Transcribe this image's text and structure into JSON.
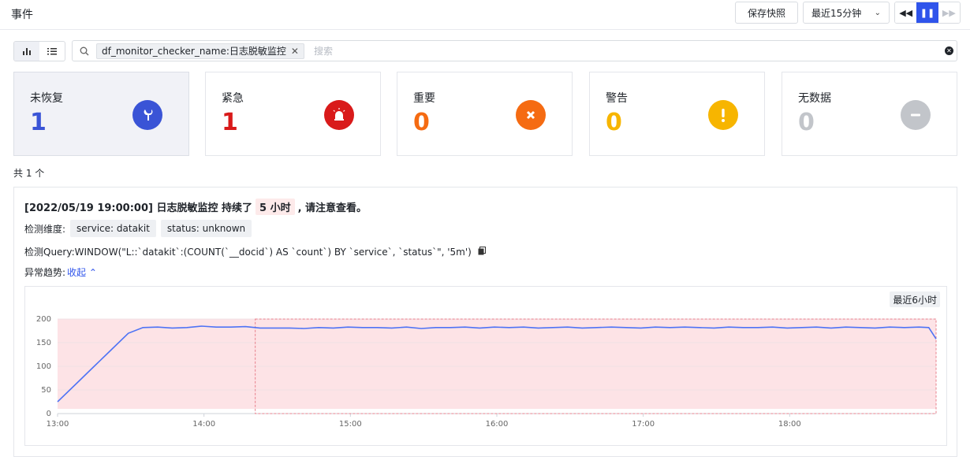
{
  "header": {
    "title": "事件",
    "save_snapshot": "保存快照",
    "time_range": "最近15分钟",
    "play_controls": [
      "◀◀",
      "❚❚",
      "▶▶"
    ]
  },
  "search": {
    "tag": "df_monitor_checker_name:日志脱敏监控",
    "placeholder": "搜索"
  },
  "stats": [
    {
      "label": "未恢复",
      "count": "1",
      "color": "#3a54d6",
      "icon": "wrench-icon"
    },
    {
      "label": "紧急",
      "count": "1",
      "color": "#d91a1a",
      "icon": "alarm-icon"
    },
    {
      "label": "重要",
      "count": "0",
      "color": "#f56b12",
      "icon": "close-icon"
    },
    {
      "label": "警告",
      "count": "0",
      "color": "#f7b500",
      "icon": "exclamation-icon"
    },
    {
      "label": "无数据",
      "count": "0",
      "color": "#c2c5ca",
      "icon": "minus-icon"
    }
  ],
  "total_text": "共 1 个",
  "event": {
    "title_prefix": "[2022/05/19 19:00:00] 日志脱敏监控 持续了",
    "duration": "5 小时",
    "title_suffix": ", 请注意查看。",
    "dimensions_label": "检测维度:",
    "dimensions": [
      "service: datakit",
      "status: unknown"
    ],
    "query_label": "检测Query:",
    "query": "WINDOW(\"L::`datakit`:(COUNT(`__docid`) AS `count`) BY `service`, `status`\", '5m')",
    "trend_label": "异常趋势:",
    "collapse_label": "收起 ⌃",
    "range_badge": "最近6小时"
  },
  "chart_data": {
    "type": "line",
    "x_ticks": [
      "13:00",
      "14:00",
      "15:00",
      "16:00",
      "17:00",
      "18:00"
    ],
    "y_ticks": [
      0,
      50,
      100,
      150,
      200
    ],
    "ylim": [
      0,
      200
    ],
    "x_range_minutes": [
      0,
      360
    ],
    "shaded_band_max": 200,
    "anomaly_window_minutes": [
      81,
      360
    ],
    "line_color": "#4e73f5",
    "points": [
      [
        0,
        25
      ],
      [
        8,
        65
      ],
      [
        15,
        100
      ],
      [
        22,
        135
      ],
      [
        29,
        170
      ],
      [
        35,
        182
      ],
      [
        41,
        183
      ],
      [
        47,
        181
      ],
      [
        53,
        182
      ],
      [
        59,
        185
      ],
      [
        65,
        183
      ],
      [
        71,
        183
      ],
      [
        77,
        184
      ],
      [
        83,
        181
      ],
      [
        89,
        181
      ],
      [
        95,
        181
      ],
      [
        101,
        180
      ],
      [
        107,
        182
      ],
      [
        113,
        181
      ],
      [
        119,
        183
      ],
      [
        125,
        182
      ],
      [
        131,
        182
      ],
      [
        137,
        181
      ],
      [
        143,
        183
      ],
      [
        149,
        180
      ],
      [
        155,
        182
      ],
      [
        161,
        182
      ],
      [
        167,
        183
      ],
      [
        173,
        181
      ],
      [
        179,
        183
      ],
      [
        185,
        182
      ],
      [
        191,
        183
      ],
      [
        197,
        181
      ],
      [
        203,
        182
      ],
      [
        209,
        183
      ],
      [
        215,
        181
      ],
      [
        221,
        182
      ],
      [
        227,
        183
      ],
      [
        233,
        182
      ],
      [
        239,
        181
      ],
      [
        245,
        183
      ],
      [
        251,
        182
      ],
      [
        257,
        183
      ],
      [
        263,
        182
      ],
      [
        269,
        181
      ],
      [
        275,
        183
      ],
      [
        281,
        182
      ],
      [
        287,
        182
      ],
      [
        293,
        183
      ],
      [
        299,
        181
      ],
      [
        305,
        182
      ],
      [
        311,
        183
      ],
      [
        317,
        181
      ],
      [
        323,
        183
      ],
      [
        329,
        182
      ],
      [
        335,
        181
      ],
      [
        341,
        183
      ],
      [
        347,
        182
      ],
      [
        353,
        183
      ],
      [
        357,
        182
      ],
      [
        360,
        158
      ]
    ]
  }
}
